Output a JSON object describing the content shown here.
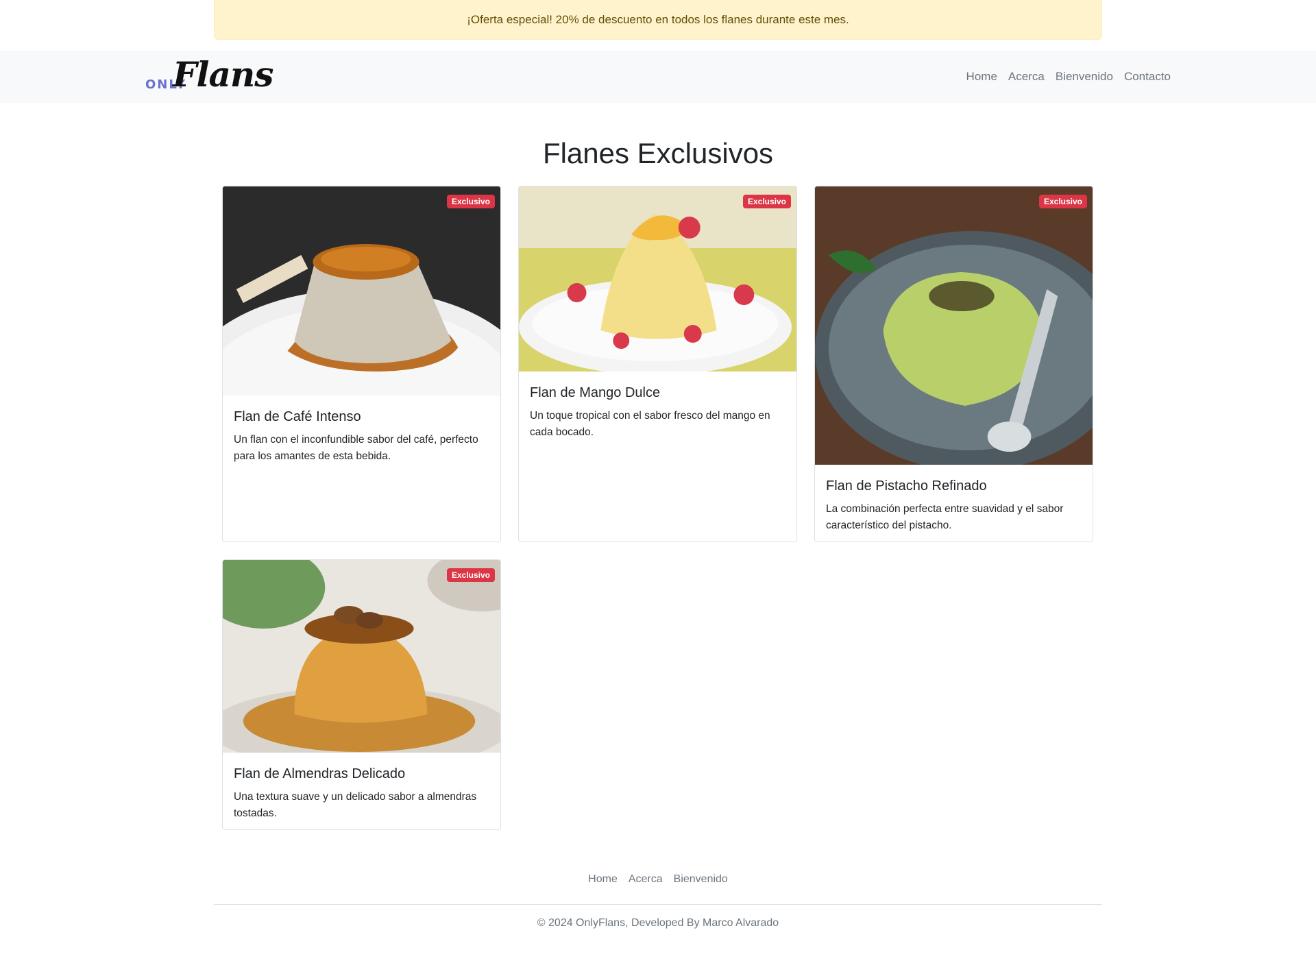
{
  "promo": {
    "text": "¡Oferta especial! 20% de descuento en todos los flanes durante este mes."
  },
  "brand": {
    "prefix": "ONLY",
    "name": "Flans"
  },
  "nav": {
    "items": [
      "Home",
      "Acerca",
      "Bienvenido",
      "Contacto"
    ]
  },
  "page": {
    "title": "Flanes Exclusivos"
  },
  "cards": [
    {
      "badge": "Exclusivo",
      "title": "Flan de Café Intenso",
      "text": "Un flan con el inconfundible sabor del café, perfecto para los amantes de esta bebida."
    },
    {
      "badge": "Exclusivo",
      "title": "Flan de Mango Dulce",
      "text": "Un toque tropical con el sabor fresco del mango en cada bocado."
    },
    {
      "badge": "Exclusivo",
      "title": "Flan de Pistacho Refinado",
      "text": "La combinación perfecta entre suavidad y el sabor característico del pistacho."
    },
    {
      "badge": "Exclusivo",
      "title": "Flan de Almendras Delicado",
      "text": "Una textura suave y un delicado sabor a almendras tostadas."
    }
  ],
  "footer": {
    "links": [
      "Home",
      "Acerca",
      "Bienvenido"
    ],
    "copyright": "© 2024 OnlyFlans, Developed By Marco Alvarado"
  },
  "colors": {
    "badge": "#dc3545",
    "alert_bg": "#fff3cd",
    "navbar_bg": "#f8f9fa",
    "brand_accent": "#6a6fd1"
  }
}
